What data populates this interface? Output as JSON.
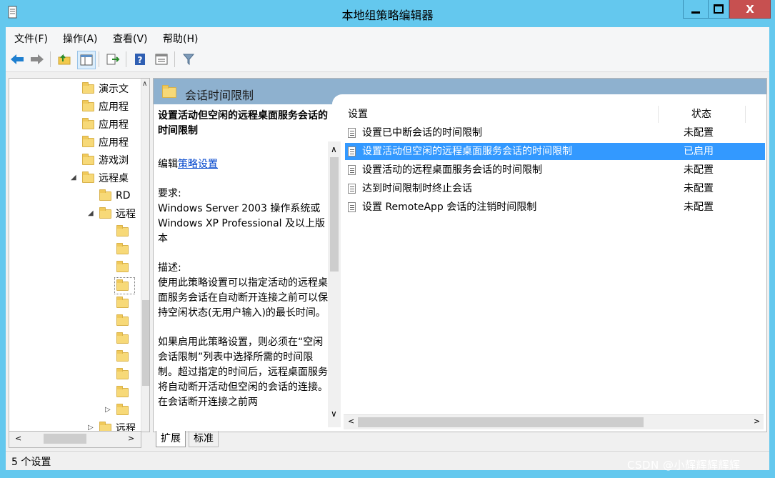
{
  "window": {
    "title": "本地组策略编辑器",
    "close_glyph": "X"
  },
  "menu": [
    {
      "label": "文件(F)"
    },
    {
      "label": "操作(A)"
    },
    {
      "label": "查看(V)"
    },
    {
      "label": "帮助(H)"
    }
  ],
  "toolbar": {
    "icons": [
      "back-arrow-icon",
      "forward-arrow-icon",
      "up-folder-icon",
      "show-hide-tree-icon",
      "export-list-icon",
      "help-icon",
      "view-icon",
      "filter-icon"
    ]
  },
  "tree": {
    "items": [
      {
        "label": "演示文"
      },
      {
        "label": "应用程"
      },
      {
        "label": "应用程"
      },
      {
        "label": "应用程"
      },
      {
        "label": "游戏浏"
      },
      {
        "label": "远程桌"
      },
      {
        "label": "RD"
      },
      {
        "label": "远程"
      }
    ],
    "last_label": "远程"
  },
  "header": {
    "title": "会话时间限制"
  },
  "description": {
    "title": "设置活动但空闲的远程桌面服务会话的时间限制",
    "edit_prefix": "编辑",
    "edit_link": "策略设置",
    "requirements_label": "要求:",
    "requirements_text": "Windows Server 2003 操作系统或 Windows XP Professional 及以上版本",
    "description_label": "描述:",
    "description_text": "使用此策略设置可以指定活动的远程桌面服务会话在自动断开连接之前可以保持空闲状态(无用户输入)的最长时间。",
    "enabled_text": "如果启用此策略设置，则必须在“空闲会话限制”列表中选择所需的时间限制。超过指定的时间后，远程桌面服务将自动断开活动但空闲的会话的连接。在会话断开连接之前两"
  },
  "list": {
    "columns": {
      "setting": "设置",
      "state": "状态"
    },
    "rows": [
      {
        "name": "设置已中断会话的时间限制",
        "state": "未配置",
        "selected": false
      },
      {
        "name": "设置活动但空闲的远程桌面服务会话的时间限制",
        "state": "已启用",
        "selected": true
      },
      {
        "name": "设置活动的远程桌面服务会话的时间限制",
        "state": "未配置",
        "selected": false
      },
      {
        "name": "达到时间限制时终止会话",
        "state": "未配置",
        "selected": false
      },
      {
        "name": "设置 RemoteApp 会话的注销时间限制",
        "state": "未配置",
        "selected": false
      }
    ]
  },
  "tabs": [
    {
      "label": "扩展"
    },
    {
      "label": "标准"
    }
  ],
  "status": {
    "text": "5 个设置"
  },
  "watermark": "CSDN @小辉辉辉辉辉",
  "colors": {
    "titlebar": "#64c8ee",
    "selection": "#3399ff",
    "header": "#8eb1cf",
    "close": "#c75050"
  }
}
